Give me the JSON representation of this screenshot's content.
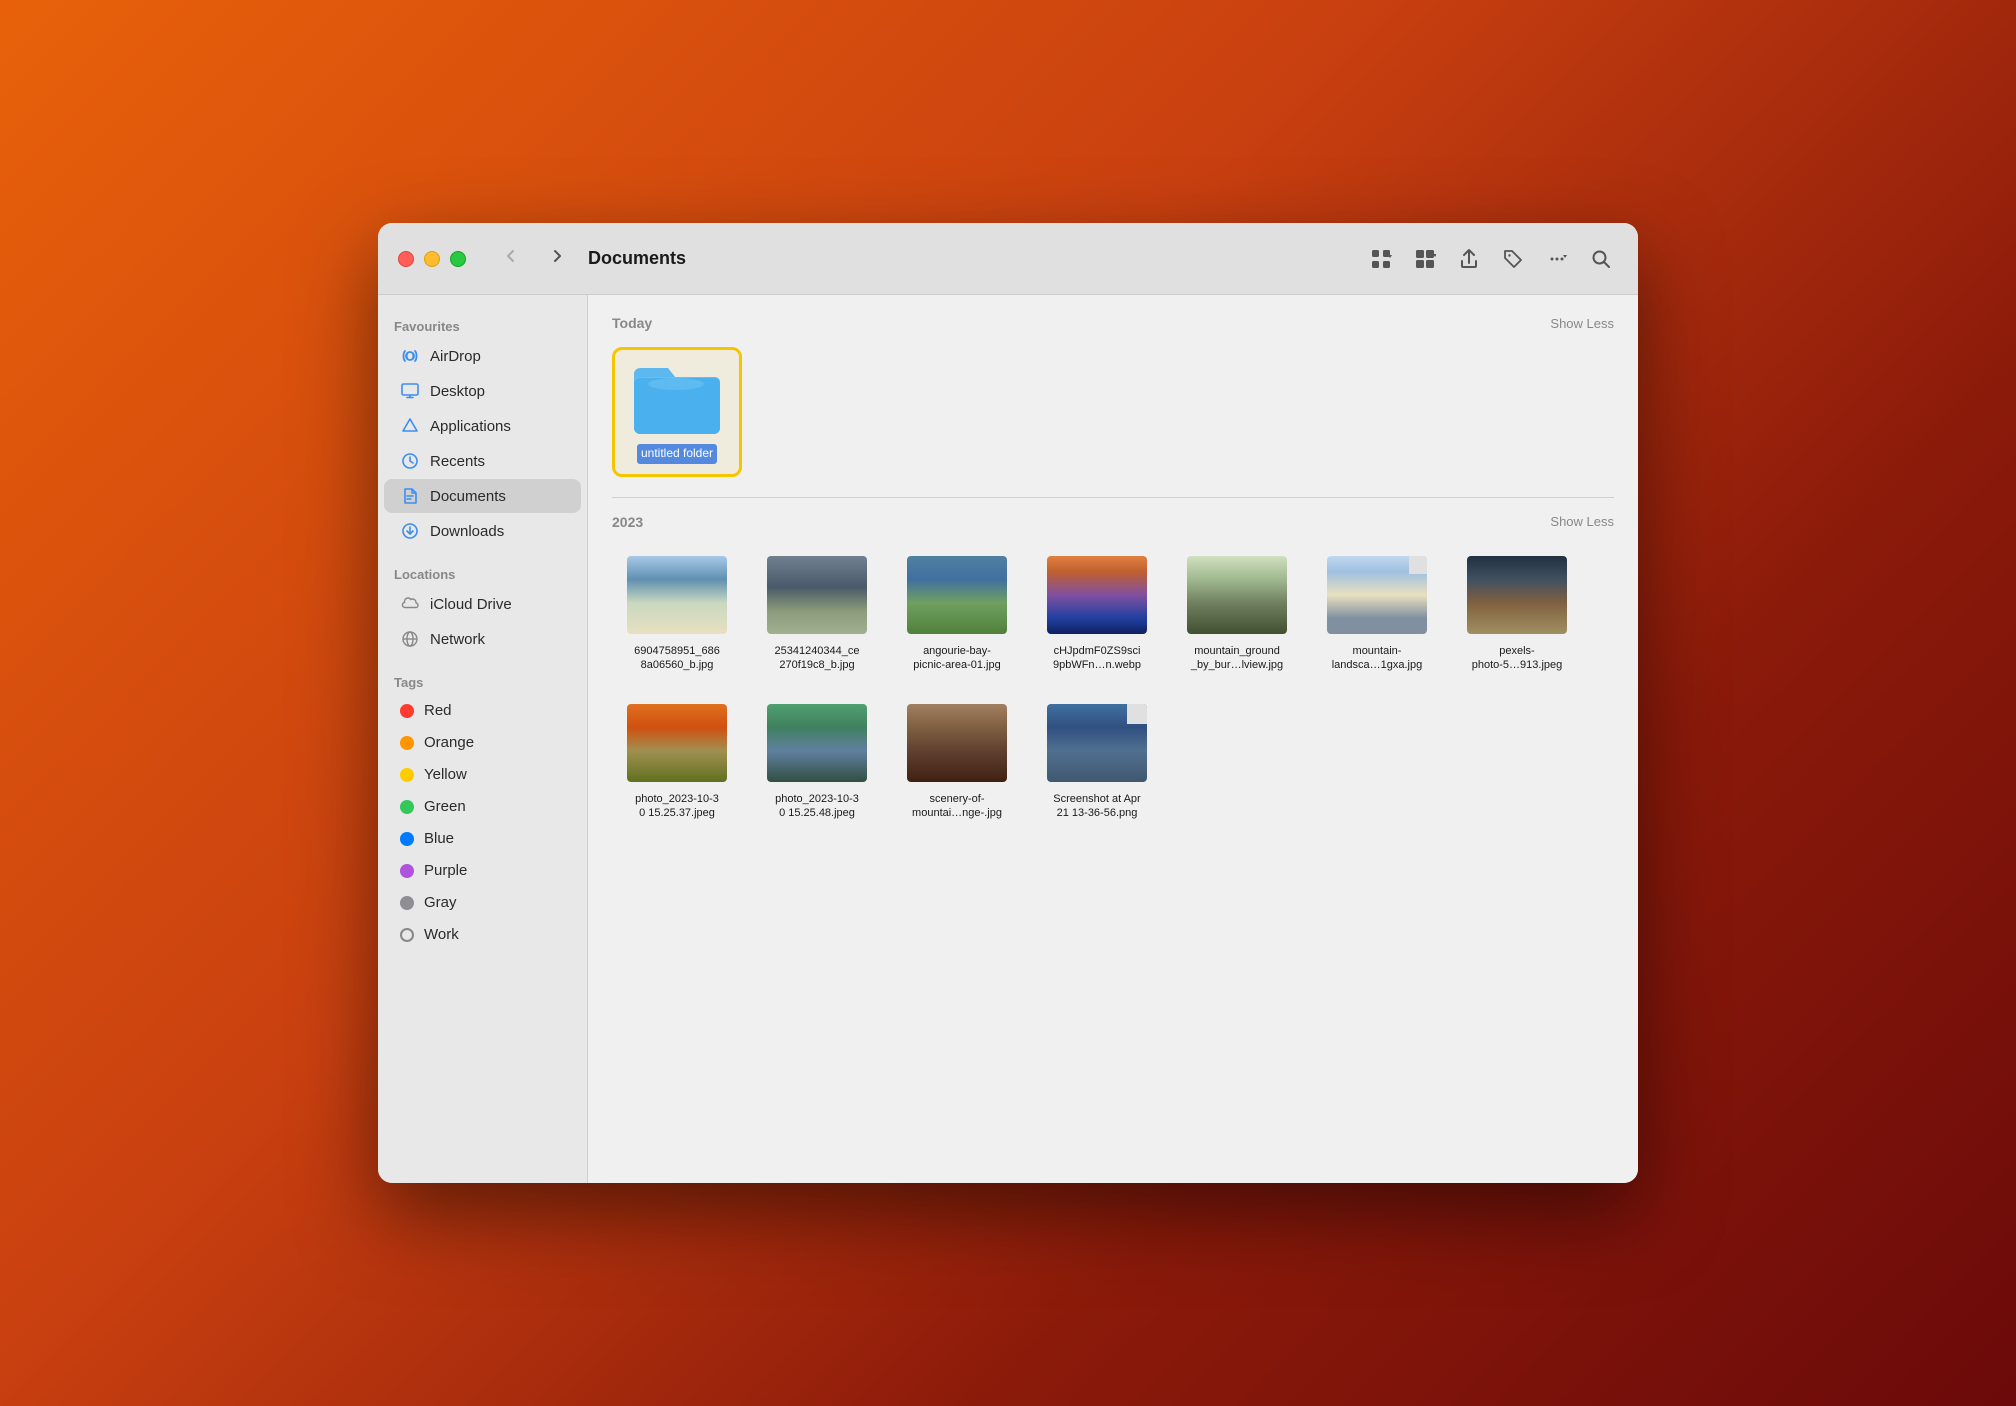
{
  "window": {
    "title": "Documents"
  },
  "titlebar": {
    "back_label": "‹",
    "forward_label": "›",
    "title": "Documents"
  },
  "toolbar": {
    "view_grid": "⊞",
    "view_list": "≡",
    "share": "↑",
    "tag": "◇",
    "more": "···",
    "search": "⌕"
  },
  "sidebar": {
    "favourites_label": "Favourites",
    "items": [
      {
        "id": "airdrop",
        "label": "AirDrop",
        "icon": "airdrop"
      },
      {
        "id": "desktop",
        "label": "Desktop",
        "icon": "desktop"
      },
      {
        "id": "applications",
        "label": "Applications",
        "icon": "applications"
      },
      {
        "id": "recents",
        "label": "Recents",
        "icon": "recents"
      },
      {
        "id": "documents",
        "label": "Documents",
        "icon": "documents",
        "active": true
      },
      {
        "id": "downloads",
        "label": "Downloads",
        "icon": "downloads"
      }
    ],
    "locations_label": "Locations",
    "locations": [
      {
        "id": "icloud",
        "label": "iCloud Drive",
        "icon": "icloud"
      },
      {
        "id": "network",
        "label": "Network",
        "icon": "network"
      }
    ],
    "tags_label": "Tags",
    "tags": [
      {
        "id": "red",
        "label": "Red",
        "color": "#ff3b30"
      },
      {
        "id": "orange",
        "label": "Orange",
        "color": "#ff9500"
      },
      {
        "id": "yellow",
        "label": "Yellow",
        "color": "#ffcc00"
      },
      {
        "id": "green",
        "label": "Green",
        "color": "#34c759"
      },
      {
        "id": "blue",
        "label": "Blue",
        "color": "#007aff"
      },
      {
        "id": "purple",
        "label": "Purple",
        "color": "#af52de"
      },
      {
        "id": "gray",
        "label": "Gray",
        "color": "#8e8e93"
      },
      {
        "id": "work",
        "label": "Work",
        "color": "work"
      }
    ]
  },
  "content": {
    "today_label": "Today",
    "show_less_1": "Show Less",
    "today_items": [
      {
        "id": "untitled-folder",
        "name": "untitled folder",
        "type": "folder",
        "selected": true
      }
    ],
    "year_label": "2023",
    "show_less_2": "Show Less",
    "year_items": [
      {
        "id": "img1",
        "name": "6904758951_686\n8a06560_b.jpg",
        "type": "photo",
        "variant": "landscape-1"
      },
      {
        "id": "img2",
        "name": "25341240344_ce\n270f19c8_b.jpg",
        "type": "photo",
        "variant": "landscape-2"
      },
      {
        "id": "img3",
        "name": "angourie-bay-\npicnic-area-01.jpg",
        "type": "photo",
        "variant": "landscape-3"
      },
      {
        "id": "img4",
        "name": "cHJpdmF0ZS9sci\n9pbWFn...n.webp",
        "type": "photo",
        "variant": "landscape-4"
      },
      {
        "id": "img5",
        "name": "mountain_ground\n_by_bur...lview.jpg",
        "type": "photo",
        "variant": "landscape-5"
      },
      {
        "id": "img6",
        "name": "mountain-\nlandca...1gxa.jpg",
        "type": "photo",
        "variant": "landscape-6"
      },
      {
        "id": "img7",
        "name": "pexels-\nphoto-5...913.jpeg",
        "type": "photo",
        "variant": "landscape-7"
      },
      {
        "id": "img8",
        "name": "photo_2023-10-3\n0 15.25.37.jpeg",
        "type": "photo",
        "variant": "landscape-8"
      },
      {
        "id": "img9",
        "name": "photo_2023-10-3\n0 15.25.48.jpeg",
        "type": "photo",
        "variant": "landscape-9"
      },
      {
        "id": "img10",
        "name": "scenery-of-\nmountai...nge-.jpg",
        "type": "photo",
        "variant": "landscape-10"
      },
      {
        "id": "img11",
        "name": "Screenshot at Apr\n21 13-36-56.png",
        "type": "photo",
        "variant": "landscape-11"
      }
    ]
  }
}
